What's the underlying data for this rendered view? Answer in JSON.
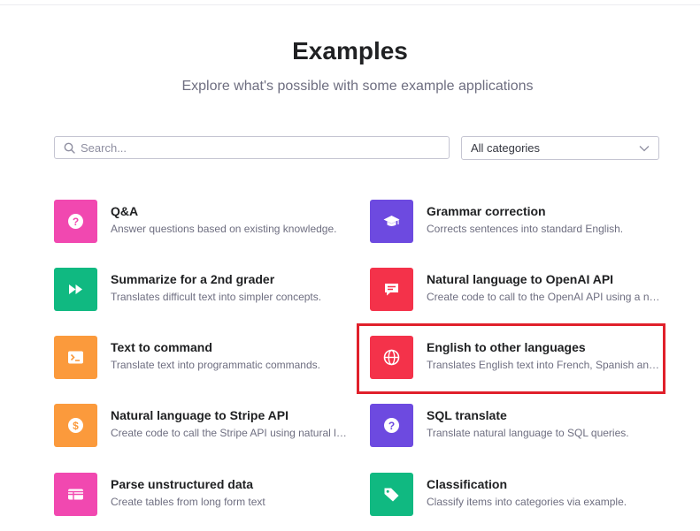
{
  "header": {
    "title": "Examples",
    "subtitle": "Explore what's possible with some example applications"
  },
  "search": {
    "placeholder": "Search...",
    "value": ""
  },
  "category_select": {
    "selected": "All categories"
  },
  "colors": {
    "pink": "#f148b0",
    "green": "#10b981",
    "orange": "#fb9a3c",
    "purple": "#6d4ae0",
    "red": "#f4324a",
    "highlight": "#e0202b"
  },
  "examples": [
    {
      "title": "Q&A",
      "description": "Answer questions based on existing knowledge.",
      "icon": "question-icon",
      "color": "pink"
    },
    {
      "title": "Grammar correction",
      "description": "Corrects sentences into standard English.",
      "icon": "graduation-cap-icon",
      "color": "purple"
    },
    {
      "title": "Summarize for a 2nd grader",
      "description": "Translates difficult text into simpler concepts.",
      "icon": "fast-forward-icon",
      "color": "green"
    },
    {
      "title": "Natural language to OpenAI API",
      "description": "Create code to call to the OpenAI API using a natural language instruction.",
      "icon": "chat-icon",
      "color": "red"
    },
    {
      "title": "Text to command",
      "description": "Translate text into programmatic commands.",
      "icon": "terminal-icon",
      "color": "orange"
    },
    {
      "title": "English to other languages",
      "description": "Translates English text into French, Spanish and Japanese.",
      "icon": "globe-icon",
      "color": "red"
    },
    {
      "title": "Natural language to Stripe API",
      "description": "Create code to call the Stripe API using natural language.",
      "icon": "dollar-icon",
      "color": "orange"
    },
    {
      "title": "SQL translate",
      "description": "Translate natural language to SQL queries.",
      "icon": "question-icon",
      "color": "purple"
    },
    {
      "title": "Parse unstructured data",
      "description": "Create tables from long form text",
      "icon": "table-icon",
      "color": "pink"
    },
    {
      "title": "Classification",
      "description": "Classify items into categories via example.",
      "icon": "tag-icon",
      "color": "green"
    }
  ]
}
